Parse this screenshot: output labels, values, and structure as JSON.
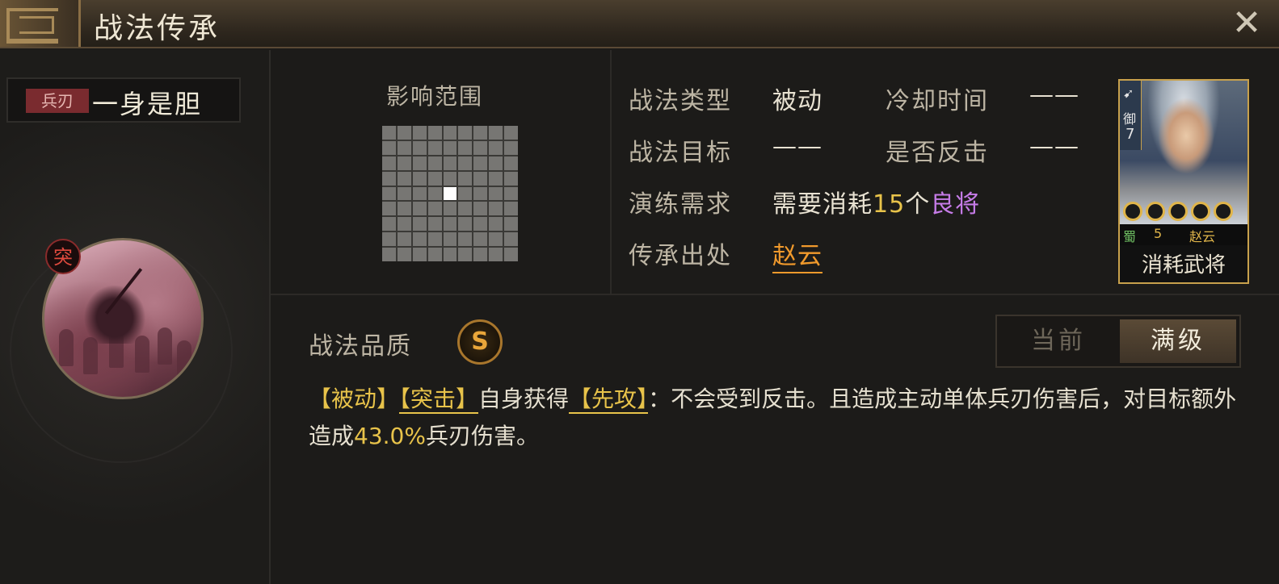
{
  "window": {
    "title": "战法传承"
  },
  "skill": {
    "type_tag": "兵刃",
    "name": "一身是胆",
    "badge": "突"
  },
  "range": {
    "label": "影响范围",
    "grid_size": 9,
    "highlight_cell": [
      4,
      4
    ]
  },
  "info": {
    "type_label": "战法类型",
    "type_value": "被动",
    "cooldown_label": "冷却时间",
    "cooldown_value": "——",
    "target_label": "战法目标",
    "target_value": "——",
    "counter_label": "是否反击",
    "counter_value": "——",
    "req_label": "演练需求",
    "req_prefix": "需要消耗",
    "req_count": "15",
    "req_unit": "个",
    "req_quality": "良将",
    "origin_label": "传承出处",
    "origin_value": "赵云"
  },
  "card": {
    "arrow": "➹",
    "troop": "御",
    "level": "7",
    "faction": "蜀",
    "cost": "5",
    "hero_name": "赵云",
    "caption": "消耗武将",
    "stars": 5
  },
  "quality": {
    "label": "战法品质",
    "grade": "S"
  },
  "toggle": {
    "current": "当前",
    "max": "满级"
  },
  "description": {
    "tag1": "【被动】",
    "tag2": "【突击】",
    "text1": "自身获得",
    "tag3": "【先攻】",
    "text2": "：不会受到反击。且造成主动单体兵刃伤害后，对目标额外造成",
    "percent": "43.0%",
    "text3": "兵刃伤害。"
  }
}
